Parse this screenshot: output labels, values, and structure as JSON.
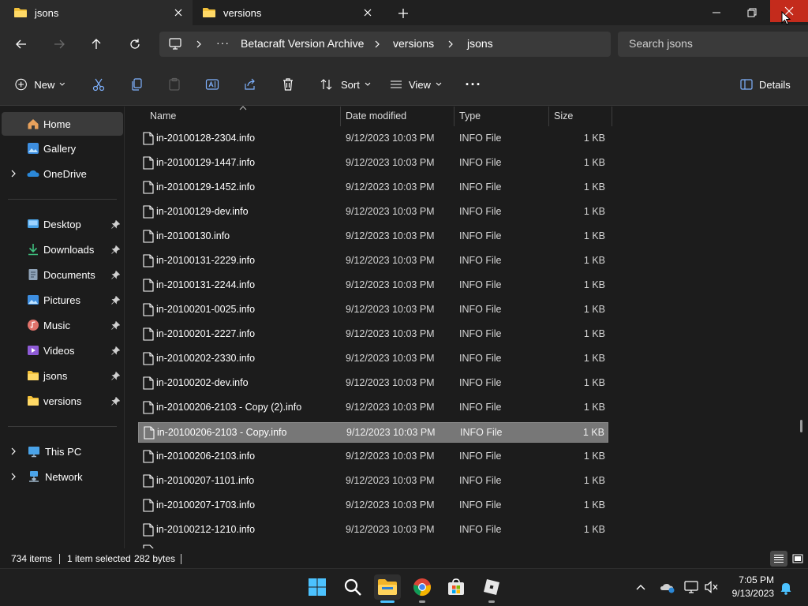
{
  "tabs": [
    {
      "label": "jsons",
      "active": true
    },
    {
      "label": "versions",
      "active": false
    }
  ],
  "address": {
    "crumbs": [
      "Betacraft Version Archive",
      "versions",
      "jsons"
    ],
    "overflow": "···"
  },
  "search": {
    "placeholder": "Search jsons"
  },
  "toolbar": {
    "new_label": "New",
    "sort_label": "Sort",
    "view_label": "View",
    "more_label": "···",
    "details_label": "Details"
  },
  "sidebar": {
    "top": [
      {
        "label": "Home",
        "icon": "home-icon",
        "selected": true
      },
      {
        "label": "Gallery",
        "icon": "gallery-icon"
      },
      {
        "label": "OneDrive",
        "icon": "onedrive-icon",
        "expandable": true
      }
    ],
    "quick": [
      {
        "label": "Desktop",
        "icon": "desktop-icon",
        "pinned": true
      },
      {
        "label": "Downloads",
        "icon": "downloads-icon",
        "pinned": true
      },
      {
        "label": "Documents",
        "icon": "documents-icon",
        "pinned": true
      },
      {
        "label": "Pictures",
        "icon": "pictures-icon",
        "pinned": true
      },
      {
        "label": "Music",
        "icon": "music-icon",
        "pinned": true
      },
      {
        "label": "Videos",
        "icon": "videos-icon",
        "pinned": true
      },
      {
        "label": "jsons",
        "icon": "folder-icon",
        "pinned": true
      },
      {
        "label": "versions",
        "icon": "folder-icon",
        "pinned": true
      }
    ],
    "bottom": [
      {
        "label": "This PC",
        "icon": "this-pc-icon",
        "expandable": true
      },
      {
        "label": "Network",
        "icon": "network-icon",
        "expandable": true
      }
    ]
  },
  "columns": {
    "name": "Name",
    "date": "Date modified",
    "type": "Type",
    "size": "Size"
  },
  "files": [
    {
      "name": "in-20100128-2304.info",
      "date": "9/12/2023 10:03 PM",
      "type": "INFO File",
      "size": "1 KB"
    },
    {
      "name": "in-20100129-1447.info",
      "date": "9/12/2023 10:03 PM",
      "type": "INFO File",
      "size": "1 KB"
    },
    {
      "name": "in-20100129-1452.info",
      "date": "9/12/2023 10:03 PM",
      "type": "INFO File",
      "size": "1 KB"
    },
    {
      "name": "in-20100129-dev.info",
      "date": "9/12/2023 10:03 PM",
      "type": "INFO File",
      "size": "1 KB"
    },
    {
      "name": "in-20100130.info",
      "date": "9/12/2023 10:03 PM",
      "type": "INFO File",
      "size": "1 KB"
    },
    {
      "name": "in-20100131-2229.info",
      "date": "9/12/2023 10:03 PM",
      "type": "INFO File",
      "size": "1 KB"
    },
    {
      "name": "in-20100131-2244.info",
      "date": "9/12/2023 10:03 PM",
      "type": "INFO File",
      "size": "1 KB"
    },
    {
      "name": "in-20100201-0025.info",
      "date": "9/12/2023 10:03 PM",
      "type": "INFO File",
      "size": "1 KB"
    },
    {
      "name": "in-20100201-2227.info",
      "date": "9/12/2023 10:03 PM",
      "type": "INFO File",
      "size": "1 KB"
    },
    {
      "name": "in-20100202-2330.info",
      "date": "9/12/2023 10:03 PM",
      "type": "INFO File",
      "size": "1 KB"
    },
    {
      "name": "in-20100202-dev.info",
      "date": "9/12/2023 10:03 PM",
      "type": "INFO File",
      "size": "1 KB"
    },
    {
      "name": "in-20100206-2103 - Copy (2).info",
      "date": "9/12/2023 10:03 PM",
      "type": "INFO File",
      "size": "1 KB"
    },
    {
      "name": "in-20100206-2103 - Copy.info",
      "date": "9/12/2023 10:03 PM",
      "type": "INFO File",
      "size": "1 KB",
      "selected": true
    },
    {
      "name": "in-20100206-2103.info",
      "date": "9/12/2023 10:03 PM",
      "type": "INFO File",
      "size": "1 KB"
    },
    {
      "name": "in-20100207-1101.info",
      "date": "9/12/2023 10:03 PM",
      "type": "INFO File",
      "size": "1 KB"
    },
    {
      "name": "in-20100207-1703.info",
      "date": "9/12/2023 10:03 PM",
      "type": "INFO File",
      "size": "1 KB"
    },
    {
      "name": "in-20100212-1210.info",
      "date": "9/12/2023 10:03 PM",
      "type": "INFO File",
      "size": "1 KB"
    }
  ],
  "status": {
    "items": "734 items",
    "selection": "1 item selected",
    "selection_size": "282 bytes"
  },
  "taskbar": {
    "time": "7:05 PM",
    "date": "9/13/2023",
    "apps": [
      "start-icon",
      "search-icon",
      "file-explorer-icon",
      "chrome-icon",
      "microsoft-store-icon",
      "roblox-icon"
    ]
  },
  "colors": {
    "close_red": "#c42b1c",
    "selected_row": "#777777",
    "folder_yellow": "#f3c13a"
  }
}
